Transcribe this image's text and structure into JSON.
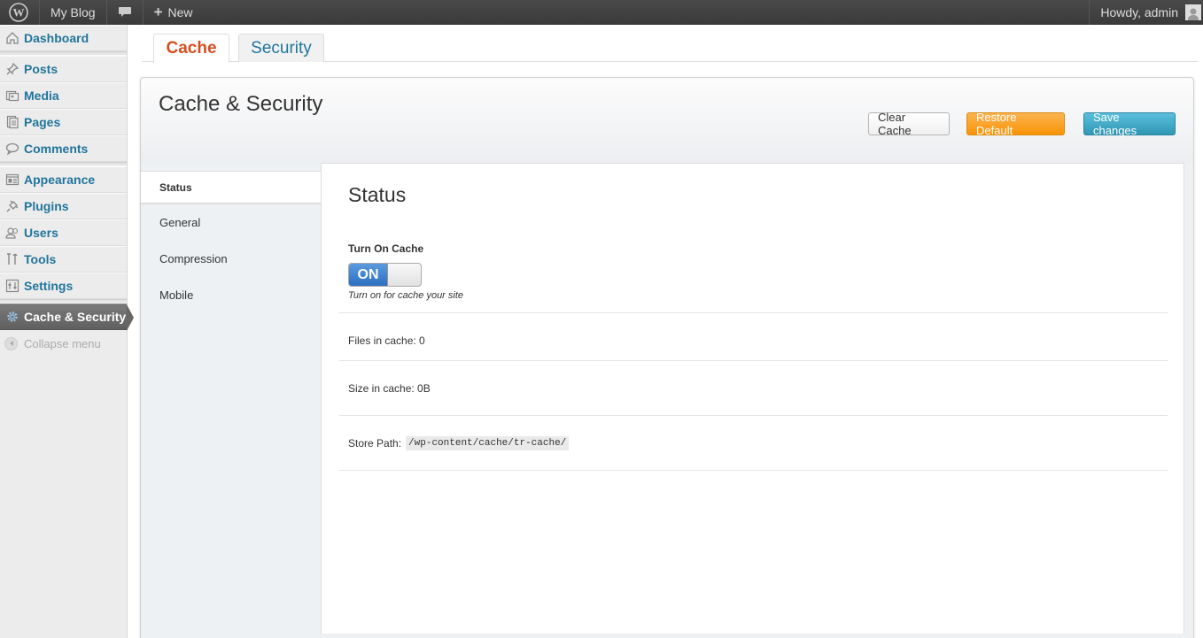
{
  "adminbar": {
    "site_name": "My Blog",
    "new_label": "New",
    "howdy": "Howdy, admin"
  },
  "sidebar": {
    "items": [
      {
        "label": "Dashboard",
        "icon": "dashboard-icon"
      },
      {
        "label": "Posts",
        "icon": "pushpin-icon"
      },
      {
        "label": "Media",
        "icon": "media-icon"
      },
      {
        "label": "Pages",
        "icon": "pages-icon"
      },
      {
        "label": "Comments",
        "icon": "comment-icon"
      },
      {
        "label": "Appearance",
        "icon": "appearance-icon"
      },
      {
        "label": "Plugins",
        "icon": "plugin-icon"
      },
      {
        "label": "Users",
        "icon": "users-icon"
      },
      {
        "label": "Tools",
        "icon": "tools-icon"
      },
      {
        "label": "Settings",
        "icon": "settings-icon"
      },
      {
        "label": "Cache & Security",
        "icon": "gear-icon"
      }
    ],
    "collapse_label": "Collapse menu"
  },
  "tabs": [
    {
      "label": "Cache"
    },
    {
      "label": "Security"
    }
  ],
  "panel": {
    "title": "Cache & Security",
    "buttons": {
      "clear": "Clear Cache",
      "restore": "Restore Default",
      "save": "Save changes"
    },
    "nav": [
      "Status",
      "General",
      "Compression",
      "Mobile"
    ]
  },
  "content": {
    "heading": "Status",
    "turn_on_label": "Turn On Cache",
    "toggle_state": "ON",
    "toggle_help": "Turn on for cache your site",
    "files_in_cache": "Files in cache: 0",
    "size_in_cache": "Size in cache: 0B",
    "store_path_label": "Store Path:",
    "store_path_value": "/wp-content/cache/tr-cache/"
  },
  "colors": {
    "link": "#21759b",
    "active_tab": "#d54e21",
    "warning": "#f89406",
    "info": "#2f96b4",
    "toggle_on": "#2c6fc2"
  }
}
